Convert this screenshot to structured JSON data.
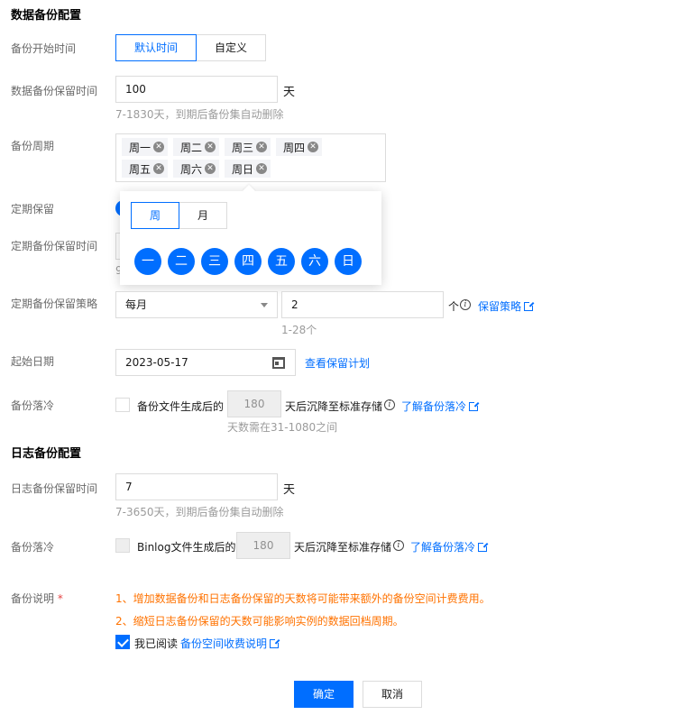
{
  "data_backup": {
    "title": "数据备份配置",
    "start_time": {
      "label": "备份开始时间",
      "options": [
        "默认时间",
        "自定义"
      ],
      "selected": "默认时间"
    },
    "retention": {
      "label": "数据备份保留时间",
      "value": "100",
      "unit": "天",
      "hint": "7-1830天，到期后备份集自动删除"
    },
    "cycle": {
      "label": "备份周期",
      "tags": [
        "周一",
        "周二",
        "周三",
        "周四",
        "周五",
        "周六",
        "周日"
      ]
    },
    "periodic_keep": {
      "label": "定期保留"
    },
    "periodic_retention": {
      "label": "定期备份保留时间",
      "hint_fragment": "9"
    },
    "popup": {
      "tabs": [
        "周",
        "月"
      ],
      "active_tab": "周",
      "days": [
        "一",
        "二",
        "三",
        "四",
        "五",
        "六",
        "日"
      ]
    },
    "policy": {
      "label": "定期备份保留策略",
      "select_value": "每月",
      "count_value": "2",
      "unit": "个",
      "link": "保留策略",
      "hint": "1-28个"
    },
    "start_date": {
      "label": "起始日期",
      "value": "2023-05-17",
      "link": "查看保留计划"
    },
    "archive": {
      "label": "备份落冷",
      "prefix": "备份文件生成后的",
      "value": "180",
      "suffix": "天后沉降至标准存储",
      "link": "了解备份落冷",
      "hint": "天数需在31-1080之间"
    }
  },
  "log_backup": {
    "title": "日志备份配置",
    "retention": {
      "label": "日志备份保留时间",
      "value": "7",
      "unit": "天",
      "hint": "7-3650天，到期后备份集自动删除"
    },
    "archive": {
      "label": "备份落冷",
      "prefix": "Binlog文件生成后的",
      "value": "180",
      "suffix": "天后沉降至标准存储",
      "link": "了解备份落冷"
    }
  },
  "notes": {
    "label": "备份说明",
    "required_mark": "*",
    "line1": "1、增加数据备份和日志备份保留的天数将可能带来额外的备份空间计费费用。",
    "line2": "2、缩短日志备份保留的天数可能影响实例的数据回档周期。",
    "agree_prefix": "我已阅读",
    "agree_link": "备份空间收费说明"
  },
  "footer": {
    "confirm": "确定",
    "cancel": "取消"
  },
  "colors": {
    "primary": "#006eff",
    "warning": "#ff7200",
    "required": "#e54545"
  }
}
